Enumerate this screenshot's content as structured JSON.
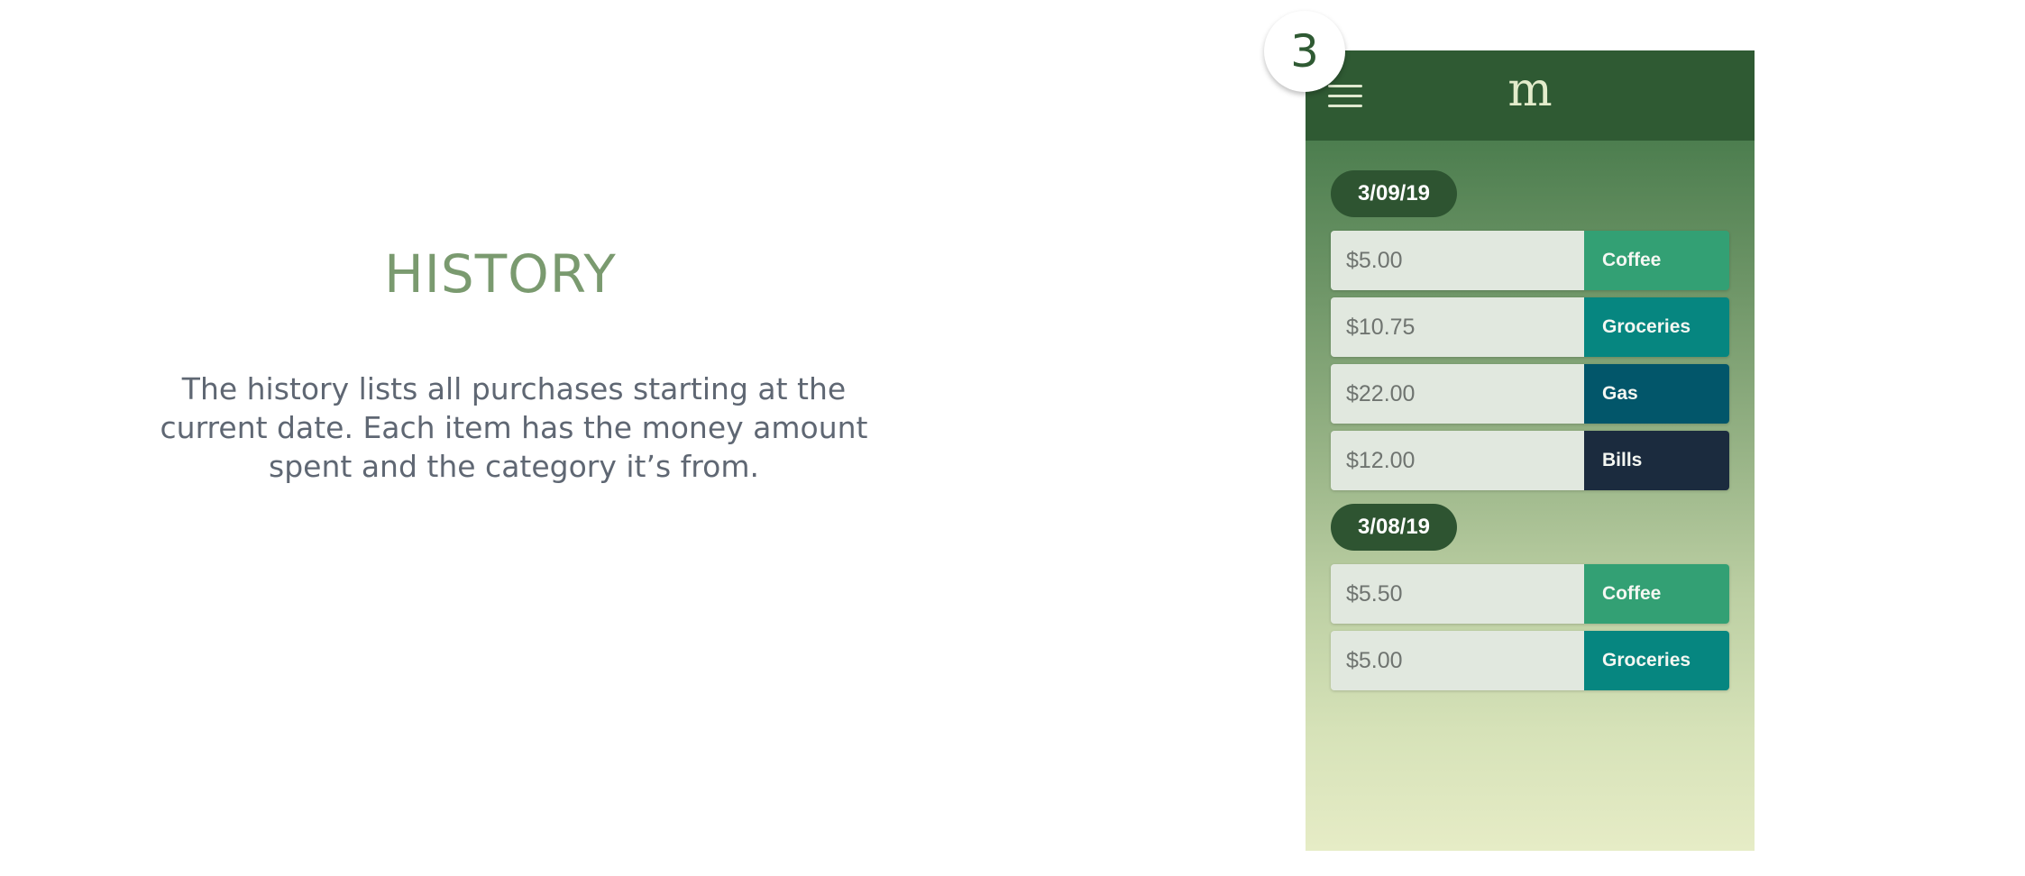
{
  "description": {
    "title": "HISTORY",
    "body": "The history lists all purchases starting at the current date. Each item has the money amount spent and the category it’s from."
  },
  "step_number": "3",
  "app": {
    "logo": "m",
    "menu_icon": "hamburger-menu-icon",
    "colors": {
      "header": "#2f5a33",
      "date_pill": "#2e5431",
      "coffee": "#33a074",
      "groceries": "#068680",
      "gas": "#02566a",
      "bills": "#1b2b3e"
    },
    "days": [
      {
        "date": "3/09/19",
        "entries": [
          {
            "amount": "$5.00",
            "category": "Coffee"
          },
          {
            "amount": "$10.75",
            "category": "Groceries"
          },
          {
            "amount": "$22.00",
            "category": "Gas"
          },
          {
            "amount": "$12.00",
            "category": "Bills"
          }
        ]
      },
      {
        "date": "3/08/19",
        "entries": [
          {
            "amount": "$5.50",
            "category": "Coffee"
          },
          {
            "amount": "$5.00",
            "category": "Groceries"
          }
        ]
      }
    ]
  }
}
